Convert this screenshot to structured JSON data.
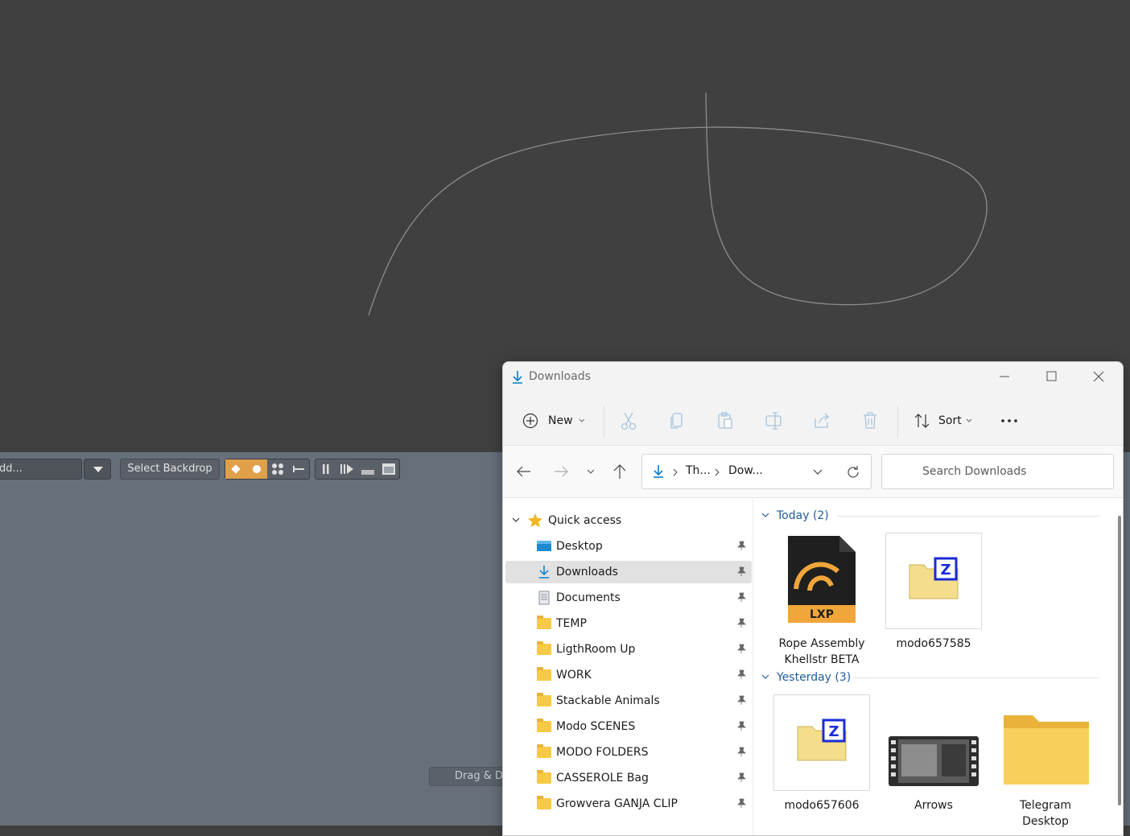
{
  "node_editor": {
    "dropdown_value": "dd...",
    "select_backdrop": "Select Backdrop",
    "drag_drop": "Drag & Dr"
  },
  "explorer": {
    "title": "Downloads",
    "toolbar": {
      "new_label": "New",
      "sort_label": "Sort"
    },
    "address": {
      "crumb1": "Th...",
      "crumb2": "Dow..."
    },
    "search_placeholder": "Search Downloads",
    "nav": {
      "quick_access": "Quick access",
      "items": [
        {
          "label": "Desktop"
        },
        {
          "label": "Downloads"
        },
        {
          "label": "Documents"
        },
        {
          "label": "TEMP"
        },
        {
          "label": "LigthRoom Up"
        },
        {
          "label": "WORK"
        },
        {
          "label": "Stackable Animals"
        },
        {
          "label": "Modo SCENES"
        },
        {
          "label": "MODO FOLDERS"
        },
        {
          "label": "CASSEROLE Bag"
        },
        {
          "label": "Growvera GANJA CLIP"
        }
      ]
    },
    "groups": [
      {
        "label": "Today (2)"
      },
      {
        "label": "Yesterday (3)"
      }
    ],
    "files": [
      {
        "name": "Rope Assembly Khellstr BETA",
        "badge": "LXP"
      },
      {
        "name": "modo657585",
        "badge": "Z"
      },
      {
        "name": "modo657606",
        "badge": "Z"
      },
      {
        "name": "Arrows"
      },
      {
        "name": "Telegram Desktop"
      }
    ],
    "colors": {
      "accent": "#0078d4",
      "folder": "#f7c948",
      "group_text": "#215d9c"
    }
  }
}
